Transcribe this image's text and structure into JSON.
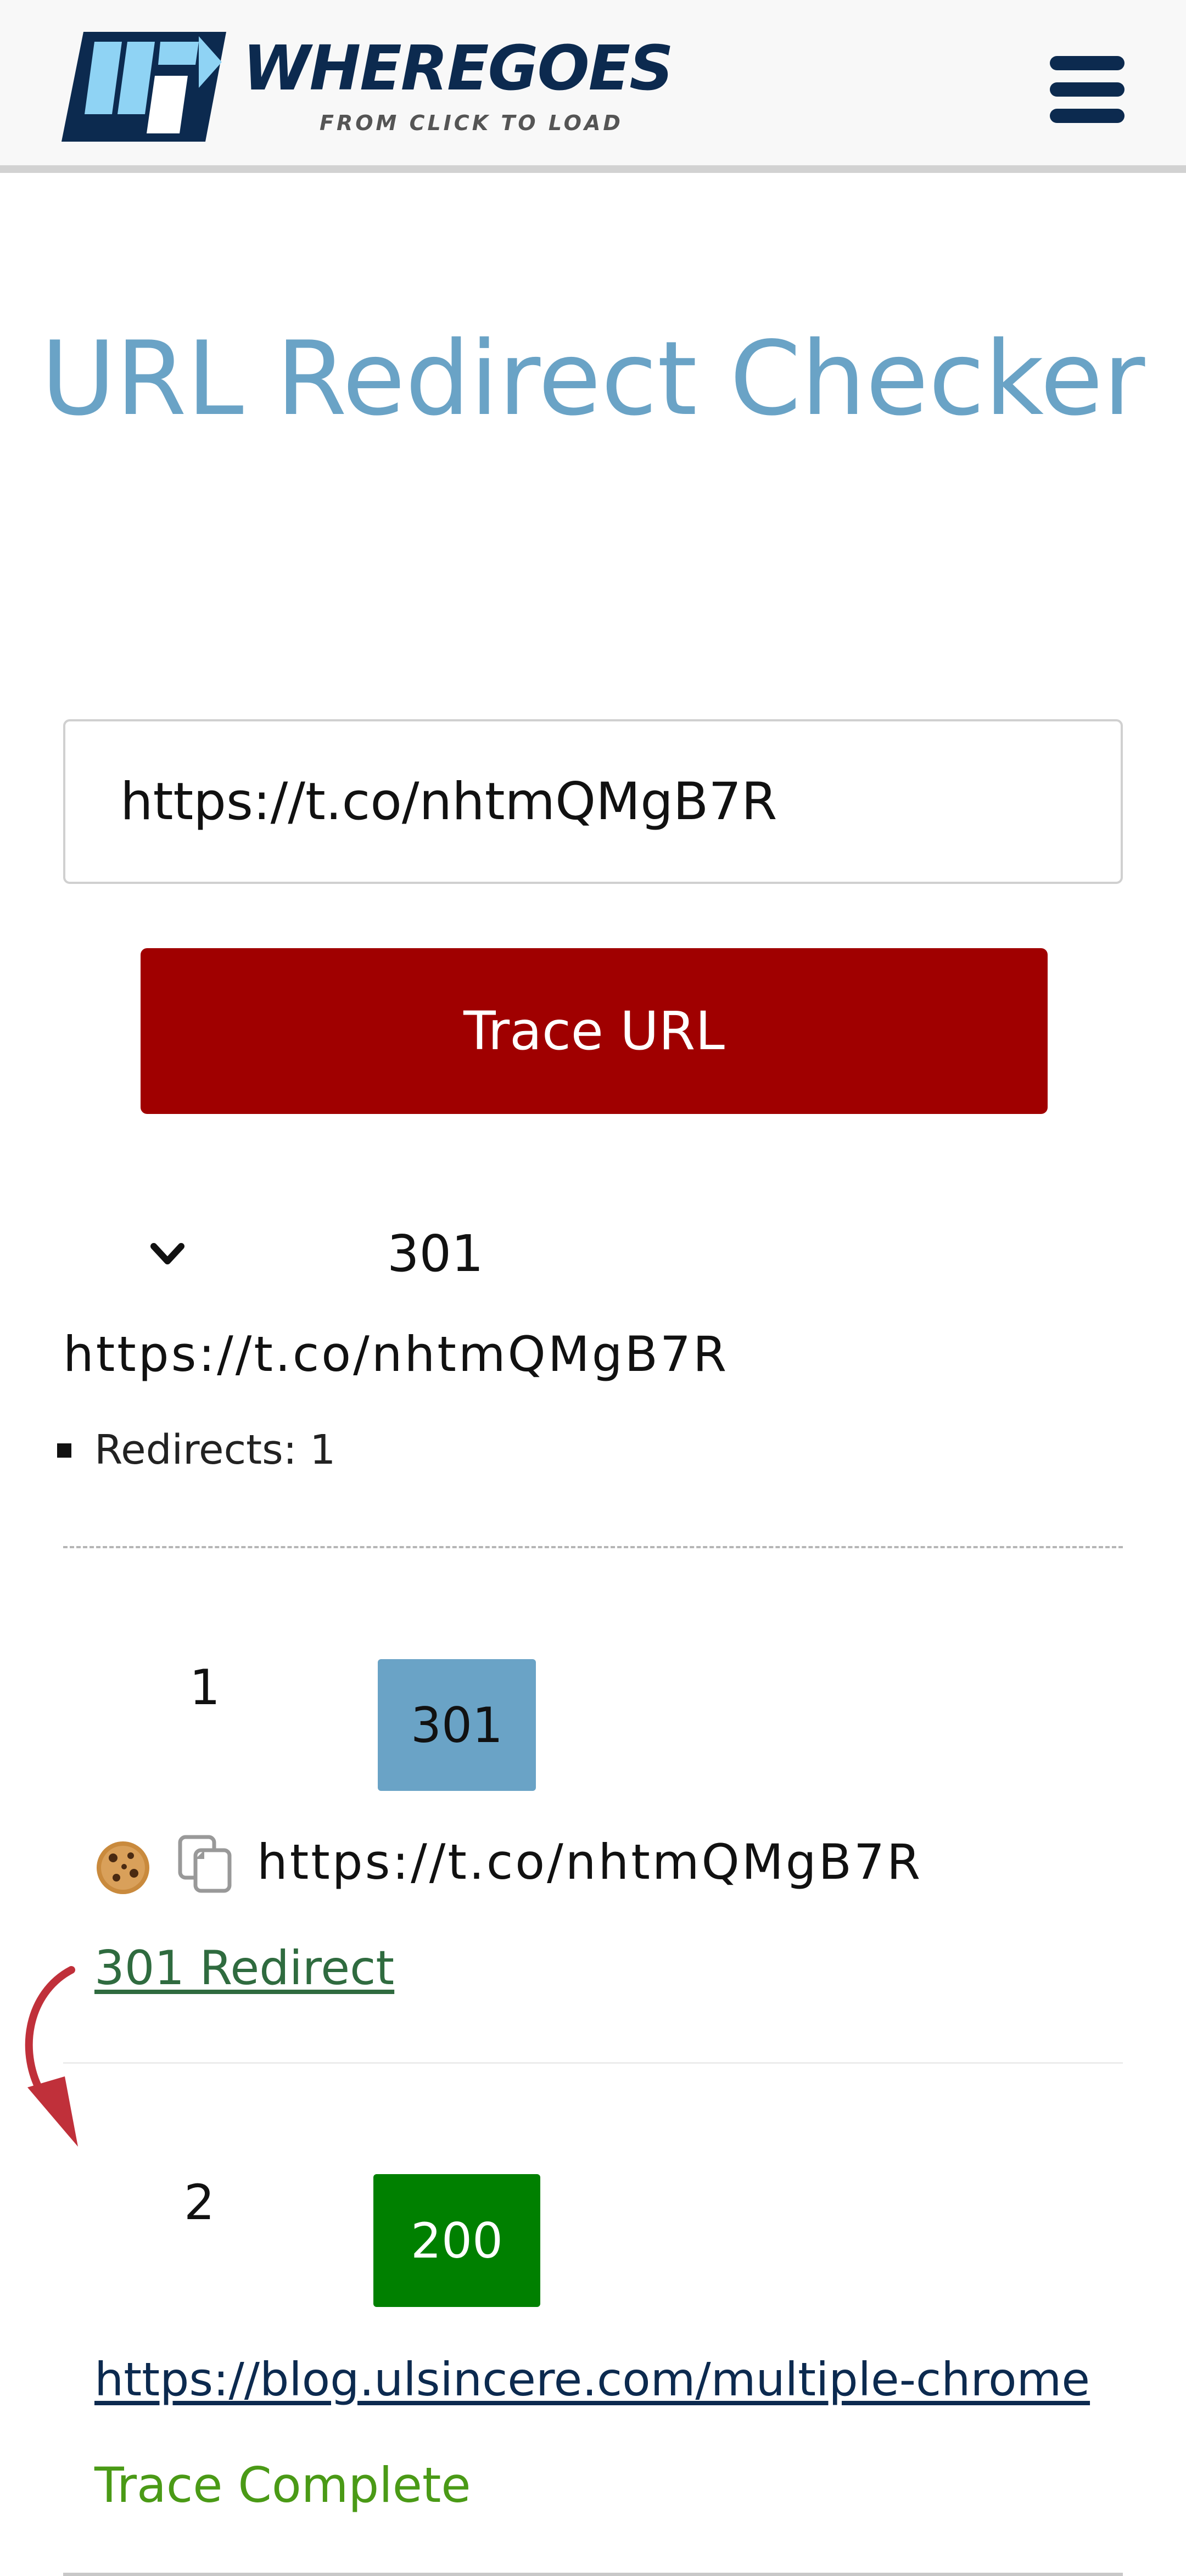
{
  "header": {
    "logo_word": "WHEREGOES",
    "logo_tagline": "FROM CLICK TO LOAD",
    "menu_icon": "hamburger-menu-icon",
    "brand_color": "#0c2a4f"
  },
  "main": {
    "title": "URL Redirect Checker",
    "title_color": "#6aa3c6",
    "url_input_value": "https://t.co/nhtmQMgB7R",
    "trace_button_label": "Trace URL",
    "trace_button_color": "#a00000"
  },
  "summary": {
    "toggle_icon": "chevron-down-icon",
    "status_code": "301",
    "url": "https://t.co/nhtmQMgB7R",
    "redirects_label": "Redirects:",
    "redirects_count": "1"
  },
  "steps": [
    {
      "number": "1",
      "status_code": "301",
      "badge_color": "#6aa3c6",
      "icons": [
        "cookie-icon",
        "copy-icon"
      ],
      "url": "https://t.co/nhtmQMgB7R",
      "status_text": "301 Redirect"
    },
    {
      "number": "2",
      "status_code": "200",
      "badge_color": "#008000",
      "url": "https://blog.ulsincere.com/multiple-chrome",
      "status_text": "Trace Complete"
    }
  ],
  "connector_icon": "curved-arrow-down-icon"
}
